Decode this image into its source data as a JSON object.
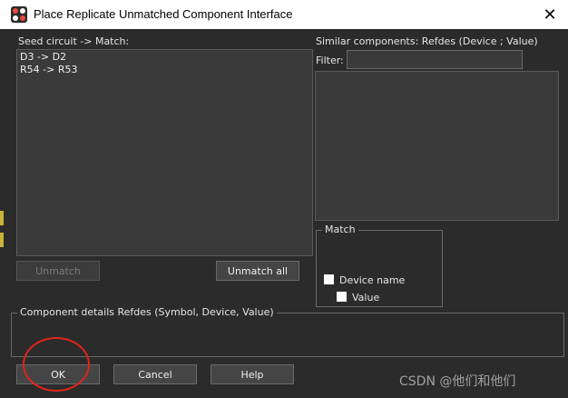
{
  "window": {
    "title": "Place Replicate Unmatched Component Interface",
    "close_glyph": "✕"
  },
  "seed": {
    "label": "Seed circuit -> Match:",
    "items": [
      "D3 -> D2",
      "R54 -> R53"
    ]
  },
  "similar": {
    "label": "Similar components:  Refdes  (Device ; Value)",
    "filter_label": "Filter:",
    "filter_value": ""
  },
  "buttons": {
    "unmatch": "Unmatch",
    "unmatch_all": "Unmatch all",
    "ok": "OK",
    "cancel": "Cancel",
    "help": "Help"
  },
  "match": {
    "title": "Match",
    "device_name": "Device name",
    "value": "Value"
  },
  "details": {
    "title": "Component details  Refdes (Symbol, Device, Value)"
  },
  "watermark": "CSDN @他们和他们",
  "colors": {
    "background": "#2b2b2b",
    "annotation_circle": "#e0241b"
  }
}
